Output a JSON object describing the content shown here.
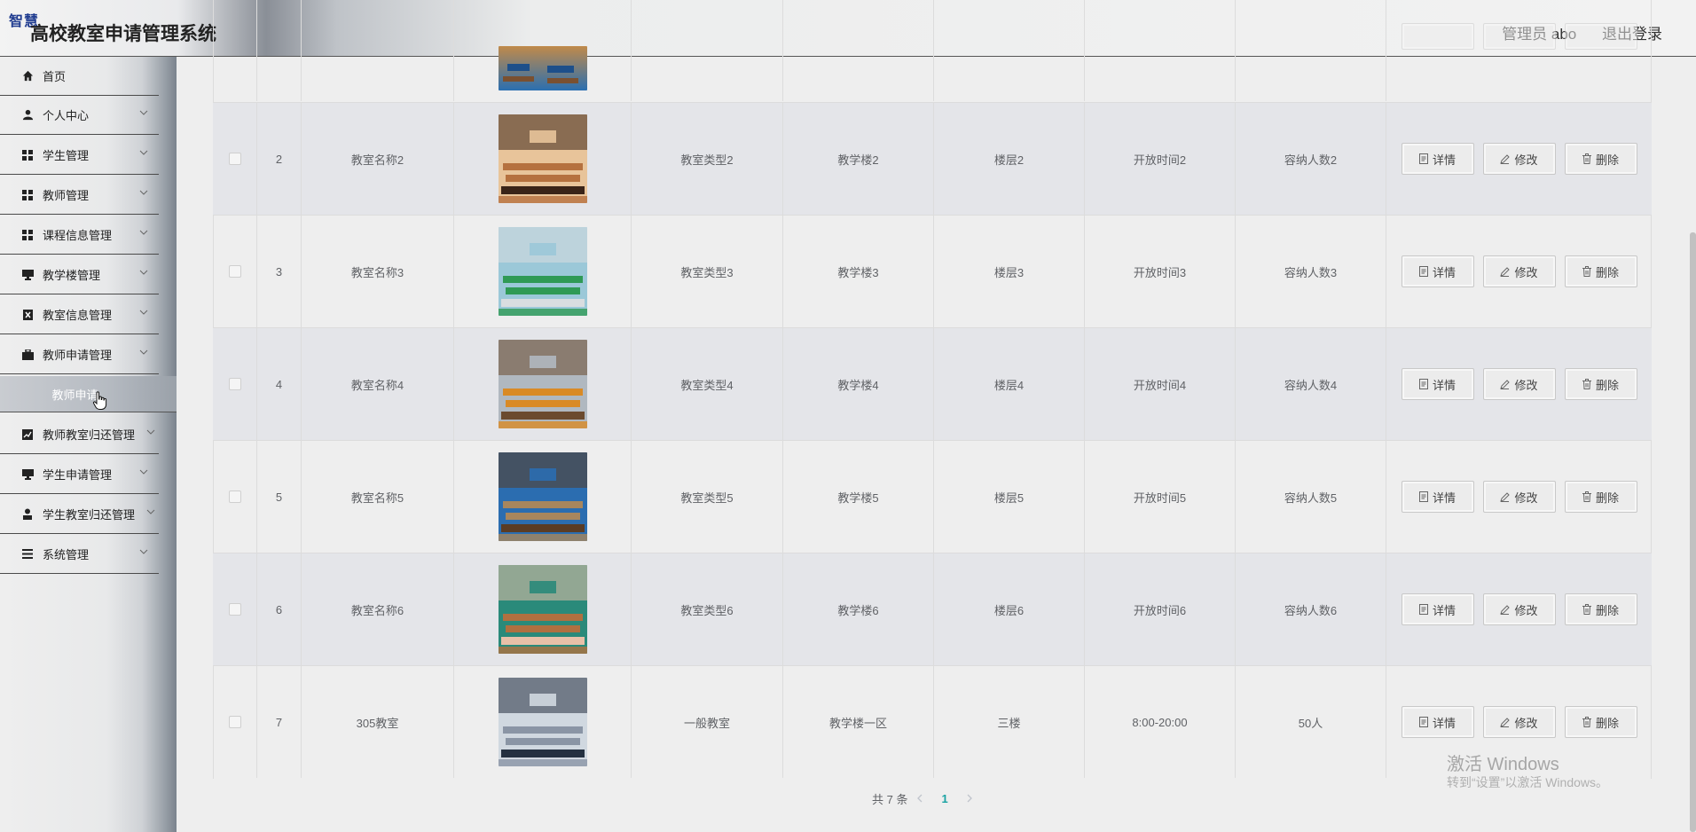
{
  "header": {
    "badge": "智慧",
    "title": "高校教室申请管理系统",
    "user": "管理员 abo",
    "logout": "退出登录"
  },
  "sidebar": {
    "items": [
      {
        "label": "首页",
        "icon": "home-icon"
      },
      {
        "label": "个人中心",
        "icon": "user-icon"
      },
      {
        "label": "学生管理",
        "icon": "grid-icon"
      },
      {
        "label": "教师管理",
        "icon": "grid-icon"
      },
      {
        "label": "课程信息管理",
        "icon": "grid-icon"
      },
      {
        "label": "教学楼管理",
        "icon": "monitor-icon"
      },
      {
        "label": "教室信息管理",
        "icon": "clipboard-icon"
      },
      {
        "label": "教师申请管理",
        "icon": "briefcase-icon"
      },
      {
        "label": "教师教室归还管理",
        "icon": "chart-icon"
      },
      {
        "label": "学生申请管理",
        "icon": "monitor-icon"
      },
      {
        "label": "学生教室归还管理",
        "icon": "person-icon"
      },
      {
        "label": "系统管理",
        "icon": "list-icon"
      }
    ],
    "active_sub": "教师申请"
  },
  "table": {
    "buttons": {
      "detail": "详情",
      "edit": "修改",
      "delete": "删除"
    },
    "rows": [
      {
        "no": "2",
        "name": "教室名称2",
        "type": "教室类型2",
        "building": "教学楼2",
        "floor": "楼层2",
        "open": "开放时间2",
        "capacity": "容纳人数2",
        "img": "img2"
      },
      {
        "no": "3",
        "name": "教室名称3",
        "type": "教室类型3",
        "building": "教学楼3",
        "floor": "楼层3",
        "open": "开放时间3",
        "capacity": "容纳人数3",
        "img": "img3"
      },
      {
        "no": "4",
        "name": "教室名称4",
        "type": "教室类型4",
        "building": "教学楼4",
        "floor": "楼层4",
        "open": "开放时间4",
        "capacity": "容纳人数4",
        "img": "img4"
      },
      {
        "no": "5",
        "name": "教室名称5",
        "type": "教室类型5",
        "building": "教学楼5",
        "floor": "楼层5",
        "open": "开放时间5",
        "capacity": "容纳人数5",
        "img": "img5"
      },
      {
        "no": "6",
        "name": "教室名称6",
        "type": "教室类型6",
        "building": "教学楼6",
        "floor": "楼层6",
        "open": "开放时间6",
        "capacity": "容纳人数6",
        "img": "img6"
      },
      {
        "no": "7",
        "name": "305教室",
        "type": "一般教室",
        "building": "教学楼一区",
        "floor": "三楼",
        "open": "8:00-20:00",
        "capacity": "50人",
        "img": "img7"
      }
    ]
  },
  "pagination": {
    "total": "共 7 条",
    "current": "1"
  },
  "watermark": {
    "line1": "激活 Windows",
    "line2": "转到“设置”以激活 Windows。"
  }
}
